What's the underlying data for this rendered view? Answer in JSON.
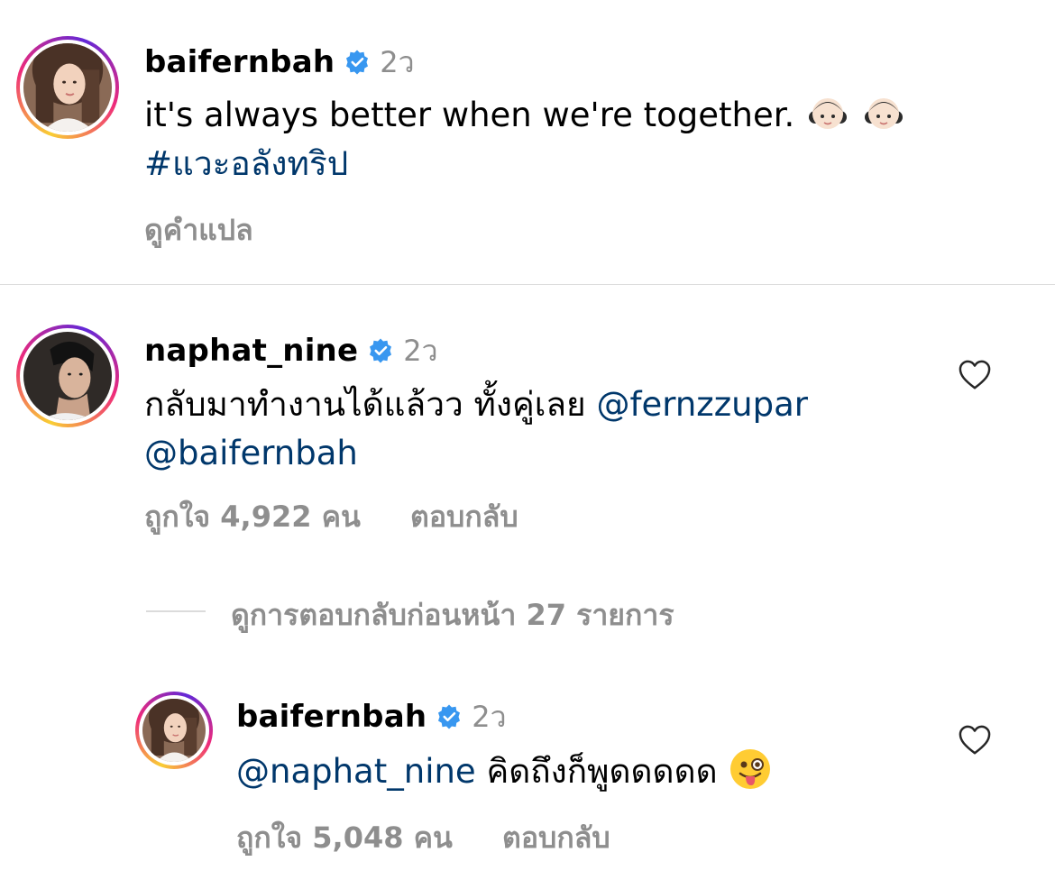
{
  "caption": {
    "username": "baifernbah",
    "time": "2ว",
    "text": "it's always better when we're together.",
    "emoji_names": [
      "girl-emoji",
      "girl-emoji"
    ],
    "hashtag": "#แวะอลังทริป",
    "translate_label": "ดูคำแปล"
  },
  "comment1": {
    "username": "naphat_nine",
    "time": "2ว",
    "text": "กลับมาทำงานได้แล้วว ทั้งคู่เลย",
    "mention1": "@fernzzupar",
    "mention2": "@baifernbah",
    "likes": "ถูกใจ 4,922 คน",
    "reply_label": "ตอบกลับ",
    "view_replies": "ดูการตอบกลับก่อนหน้า 27 รายการ"
  },
  "reply1": {
    "username": "baifernbah",
    "time": "2ว",
    "mention": "@naphat_nine",
    "text": "คิดถึงก็พูดดดดด",
    "emoji_name": "winking-tongue-emoji",
    "likes": "ถูกใจ 5,048 คน",
    "reply_label": "ตอบกลับ"
  },
  "colors": {
    "link": "#00376b",
    "secondary_text": "#8e8e8e",
    "verified_blue": "#3897f0",
    "divider": "#dbdbdb"
  }
}
